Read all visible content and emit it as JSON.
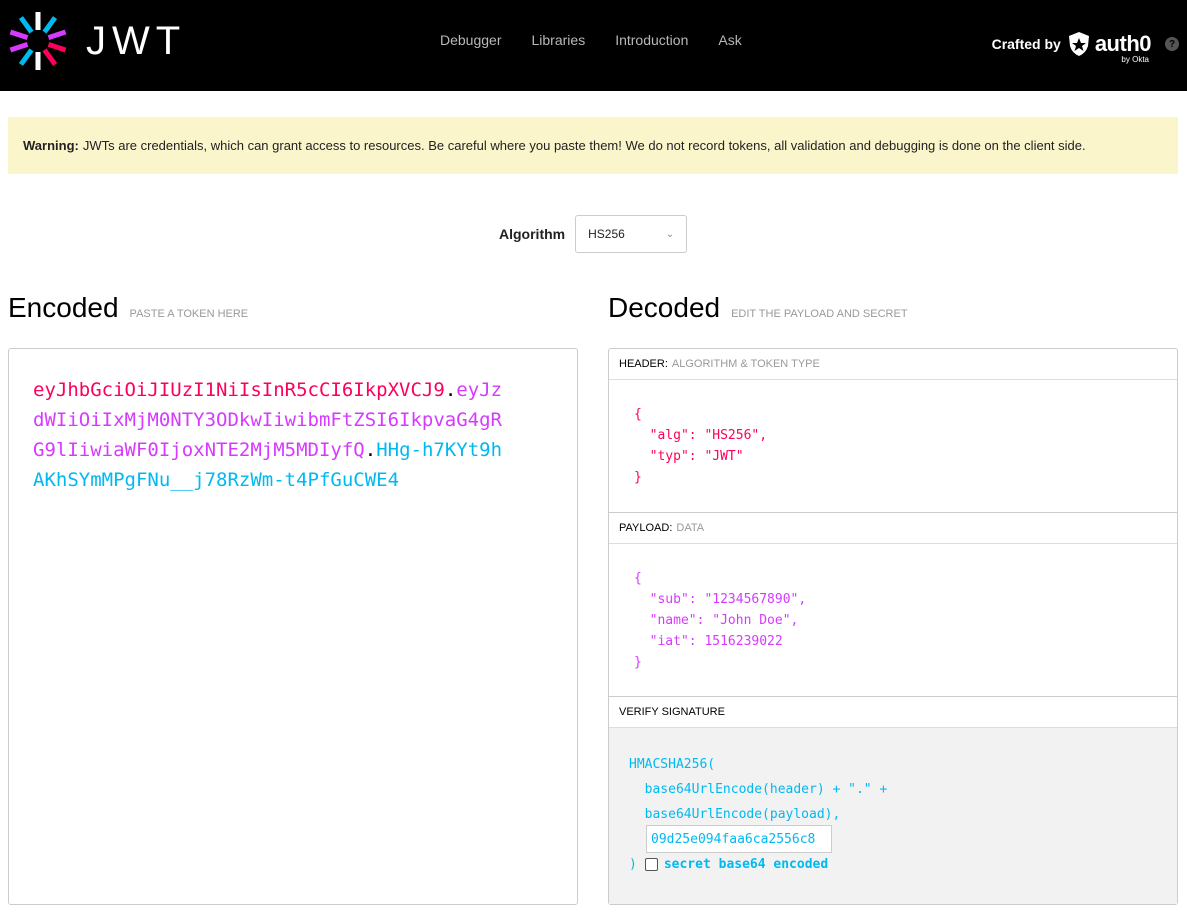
{
  "nav": {
    "items": [
      "Debugger",
      "Libraries",
      "Introduction",
      "Ask"
    ],
    "crafted_by": "Crafted by",
    "brand": "auth0",
    "brand_sub": "by Okta",
    "help": "?"
  },
  "logo": {
    "text": "JWT"
  },
  "warning": {
    "label": "Warning:",
    "text": "JWTs are credentials, which can grant access to resources. Be careful where you paste them! We do not record tokens, all validation and debugging is done on the client side."
  },
  "algorithm": {
    "label": "Algorithm",
    "value": "HS256"
  },
  "encoded": {
    "title": "Encoded",
    "hint": "PASTE A TOKEN HERE",
    "token_header": "eyJhbGciOiJIUzI1NiIsInR5cCI6IkpXVCJ9",
    "token_payload": "eyJzdWIiOiIxMjM0NTY3ODkwIiwibmFtZSI6IkpvaG4gRG9lIiwiaWF0IjoxNTE2MjM5MDIyfQ",
    "token_signature": "HHg-h7KYt9hAKhSYmMPgFNu__j78RzWm-t4PfGuCWE4",
    "dot": "."
  },
  "decoded": {
    "title": "Decoded",
    "hint": "EDIT THE PAYLOAD AND SECRET",
    "header_label": "HEADER:",
    "header_sub": "ALGORITHM & TOKEN TYPE",
    "header_json": "{\n  \"alg\": \"HS256\",\n  \"typ\": \"JWT\"\n}",
    "payload_label": "PAYLOAD:",
    "payload_sub": "DATA",
    "payload_json": "{\n  \"sub\": \"1234567890\",\n  \"name\": \"John Doe\",\n  \"iat\": 1516239022\n}",
    "verify_label": "VERIFY SIGNATURE",
    "sig_line1": "HMACSHA256(",
    "sig_line2": "  base64UrlEncode(header) + \".\" +",
    "sig_line3": "  base64UrlEncode(payload),",
    "secret_value": "09d25e094faa6ca2556c8",
    "sig_close": ")",
    "secret_b64_label": "secret base64 encoded"
  }
}
